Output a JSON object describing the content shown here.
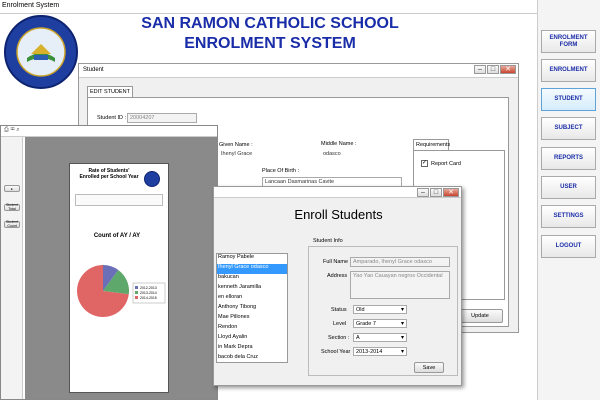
{
  "app": {
    "title": "Enrolment System"
  },
  "header": {
    "line1": "SAN RAMON CATHOLIC SCHOOL",
    "line2": "ENROLMENT SYSTEM"
  },
  "sidebar": {
    "items": [
      {
        "label": "ENROLMENT FORM"
      },
      {
        "label": "ENROLMENT"
      },
      {
        "label": "STUDENT"
      },
      {
        "label": "SUBJECT"
      },
      {
        "label": "REPORTS"
      },
      {
        "label": "USER"
      },
      {
        "label": "SETTINGS"
      },
      {
        "label": "LOGOUT"
      }
    ]
  },
  "student_window": {
    "title": "Student",
    "tab": "EDIT STUDENT",
    "student_id_label": "Student ID :",
    "student_id": "20004207",
    "given_name_label": "Given Name :",
    "given_name": "Ihenyl Grace",
    "middle_name_label": "Middle Name :",
    "middle_name": "odasco",
    "place_of_birth_label": "Place Of Birth :",
    "place_of_birth": "Lancaan Dasmarinas Cavite",
    "requirements_tab": "Requirements",
    "report_card": "Report Card",
    "update_button": "Update"
  },
  "enroll_window": {
    "title": "Enroll Students",
    "section_label": "Student Info",
    "students": [
      "Ramoy Pabele",
      "Ihenyl Grace odasco",
      "bakucan",
      "kenneth Jaramilla",
      "en elloran",
      "Anthony Tibong",
      "Mae Pillones",
      "Rendon",
      "Lloyd Ayalin",
      "in Mark Depra",
      "bacob dela Cruz"
    ],
    "selected_index": 1,
    "full_name_label": "Full Name :",
    "full_name": "Amparado, Ihenyl Grace odasco",
    "address_label": "Address",
    "address": "Yao Yao Cauayan negros Occidental",
    "status_label": "Status",
    "status": "Old",
    "level_label": "Level",
    "level": "Grade 7",
    "section_field_label": "Section :",
    "section": "A",
    "school_year_label": "School Year",
    "school_year": "2013-2014",
    "save_button": "Save"
  },
  "report_window": {
    "report_title": "Rate of Students' Enrolled per School Year",
    "chart_title": "Count of AY / AY",
    "left_buttons": [
      "Student Total",
      "Student Count"
    ]
  },
  "chart_data": {
    "type": "pie",
    "title": "Count of AY / AY",
    "categories": [
      "2012-2013",
      "2013-2014",
      "2014-2015"
    ],
    "values": [
      10,
      17,
      73
    ],
    "colors": [
      "#6b6fb8",
      "#5fa86b",
      "#e06666"
    ]
  }
}
